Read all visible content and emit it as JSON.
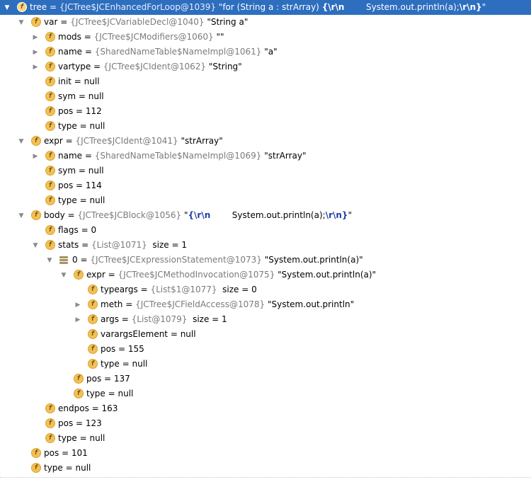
{
  "debugger_tree": {
    "rows": [
      {
        "depth": 0,
        "expand": "down",
        "icon": "field",
        "selected": true,
        "name": "tree",
        "eq": " = ",
        "ref": "{JCTree$JCEnhancedForLoop@1039}",
        "value_parts": [
          {
            "t": " \"for (String a : strArray) "
          },
          {
            "t": "{\\r\\n",
            "esc": true
          },
          {
            "t": "        System.out.println(a);"
          },
          {
            "t": "\\r\\n}",
            "esc": true
          },
          {
            "t": "\""
          }
        ]
      },
      {
        "depth": 1,
        "expand": "down",
        "icon": "field",
        "name": "var",
        "eq": " = ",
        "ref": "{JCTree$JCVariableDecl@1040}",
        "value_parts": [
          {
            "t": " \"String a\""
          }
        ]
      },
      {
        "depth": 2,
        "expand": "right",
        "icon": "field",
        "name": "mods",
        "eq": " = ",
        "ref": "{JCTree$JCModifiers@1060}",
        "value_parts": [
          {
            "t": " \"\""
          }
        ]
      },
      {
        "depth": 2,
        "expand": "right",
        "icon": "field",
        "name": "name",
        "eq": " = ",
        "ref": "{SharedNameTable$NameImpl@1061}",
        "value_parts": [
          {
            "t": " \"a\""
          }
        ]
      },
      {
        "depth": 2,
        "expand": "right",
        "icon": "field",
        "name": "vartype",
        "eq": " = ",
        "ref": "{JCTree$JCIdent@1062}",
        "value_parts": [
          {
            "t": " \"String\""
          }
        ]
      },
      {
        "depth": 2,
        "expand": "none",
        "icon": "field",
        "name": "init",
        "eq": " = ",
        "ref": "",
        "value_parts": [
          {
            "t": "null"
          }
        ]
      },
      {
        "depth": 2,
        "expand": "none",
        "icon": "field",
        "name": "sym",
        "eq": " = ",
        "ref": "",
        "value_parts": [
          {
            "t": "null"
          }
        ]
      },
      {
        "depth": 2,
        "expand": "none",
        "icon": "field",
        "name": "pos",
        "eq": " = ",
        "ref": "",
        "value_parts": [
          {
            "t": "112"
          }
        ]
      },
      {
        "depth": 2,
        "expand": "none",
        "icon": "field",
        "name": "type",
        "eq": " = ",
        "ref": "",
        "value_parts": [
          {
            "t": "null"
          }
        ]
      },
      {
        "depth": 1,
        "expand": "down",
        "icon": "field",
        "name": "expr",
        "eq": " = ",
        "ref": "{JCTree$JCIdent@1041}",
        "value_parts": [
          {
            "t": " \"strArray\""
          }
        ]
      },
      {
        "depth": 2,
        "expand": "right",
        "icon": "field",
        "name": "name",
        "eq": " = ",
        "ref": "{SharedNameTable$NameImpl@1069}",
        "value_parts": [
          {
            "t": " \"strArray\""
          }
        ]
      },
      {
        "depth": 2,
        "expand": "none",
        "icon": "field",
        "name": "sym",
        "eq": " = ",
        "ref": "",
        "value_parts": [
          {
            "t": "null"
          }
        ]
      },
      {
        "depth": 2,
        "expand": "none",
        "icon": "field",
        "name": "pos",
        "eq": " = ",
        "ref": "",
        "value_parts": [
          {
            "t": "114"
          }
        ]
      },
      {
        "depth": 2,
        "expand": "none",
        "icon": "field",
        "name": "type",
        "eq": " = ",
        "ref": "",
        "value_parts": [
          {
            "t": "null"
          }
        ]
      },
      {
        "depth": 1,
        "expand": "down",
        "icon": "field",
        "name": "body",
        "eq": " = ",
        "ref": "{JCTree$JCBlock@1056}",
        "value_parts": [
          {
            "t": " \""
          },
          {
            "t": "{\\r\\n",
            "esc": true
          },
          {
            "t": "        System.out.println(a);"
          },
          {
            "t": "\\r\\n}",
            "esc": true
          },
          {
            "t": "\""
          }
        ]
      },
      {
        "depth": 2,
        "expand": "none",
        "icon": "field",
        "name": "flags",
        "eq": " = ",
        "ref": "",
        "value_parts": [
          {
            "t": "0"
          }
        ]
      },
      {
        "depth": 2,
        "expand": "down",
        "icon": "field",
        "name": "stats",
        "eq": " = ",
        "ref": "{List@1071}",
        "value_parts": [
          {
            "t": "  size = 1"
          }
        ]
      },
      {
        "depth": 3,
        "expand": "down",
        "icon": "array",
        "name": "0",
        "eq": " = ",
        "ref": "{JCTree$JCExpressionStatement@1073}",
        "value_parts": [
          {
            "t": " \"System.out.println(a)\""
          }
        ]
      },
      {
        "depth": 4,
        "expand": "down",
        "icon": "field",
        "name": "expr",
        "eq": " = ",
        "ref": "{JCTree$JCMethodInvocation@1075}",
        "value_parts": [
          {
            "t": " \"System.out.println(a)\""
          }
        ]
      },
      {
        "depth": 5,
        "expand": "none",
        "icon": "field",
        "name": "typeargs",
        "eq": " = ",
        "ref": "{List$1@1077}",
        "value_parts": [
          {
            "t": "  size = 0"
          }
        ]
      },
      {
        "depth": 5,
        "expand": "right",
        "icon": "field",
        "name": "meth",
        "eq": " = ",
        "ref": "{JCTree$JCFieldAccess@1078}",
        "value_parts": [
          {
            "t": " \"System.out.println\""
          }
        ]
      },
      {
        "depth": 5,
        "expand": "right",
        "icon": "field",
        "name": "args",
        "eq": " = ",
        "ref": "{List@1079}",
        "value_parts": [
          {
            "t": "  size = 1"
          }
        ]
      },
      {
        "depth": 5,
        "expand": "none",
        "icon": "field",
        "name": "varargsElement",
        "eq": " = ",
        "ref": "",
        "value_parts": [
          {
            "t": "null"
          }
        ]
      },
      {
        "depth": 5,
        "expand": "none",
        "icon": "field",
        "name": "pos",
        "eq": " = ",
        "ref": "",
        "value_parts": [
          {
            "t": "155"
          }
        ]
      },
      {
        "depth": 5,
        "expand": "none",
        "icon": "field",
        "name": "type",
        "eq": " = ",
        "ref": "",
        "value_parts": [
          {
            "t": "null"
          }
        ]
      },
      {
        "depth": 4,
        "expand": "none",
        "icon": "field",
        "name": "pos",
        "eq": " = ",
        "ref": "",
        "value_parts": [
          {
            "t": "137"
          }
        ]
      },
      {
        "depth": 4,
        "expand": "none",
        "icon": "field",
        "name": "type",
        "eq": " = ",
        "ref": "",
        "value_parts": [
          {
            "t": "null"
          }
        ]
      },
      {
        "depth": 2,
        "expand": "none",
        "icon": "field",
        "name": "endpos",
        "eq": " = ",
        "ref": "",
        "value_parts": [
          {
            "t": "163"
          }
        ]
      },
      {
        "depth": 2,
        "expand": "none",
        "icon": "field",
        "name": "pos",
        "eq": " = ",
        "ref": "",
        "value_parts": [
          {
            "t": "123"
          }
        ]
      },
      {
        "depth": 2,
        "expand": "none",
        "icon": "field",
        "name": "type",
        "eq": " = ",
        "ref": "",
        "value_parts": [
          {
            "t": "null"
          }
        ]
      },
      {
        "depth": 1,
        "expand": "none",
        "icon": "field",
        "name": "pos",
        "eq": " = ",
        "ref": "",
        "value_parts": [
          {
            "t": "101"
          }
        ]
      },
      {
        "depth": 1,
        "expand": "none",
        "icon": "field",
        "name": "type",
        "eq": " = ",
        "ref": "",
        "value_parts": [
          {
            "t": "null"
          }
        ]
      }
    ]
  },
  "icons": {
    "expanded": "chevron-down-icon",
    "collapsed": "chevron-right-icon",
    "field": "field-f-icon",
    "array": "array-element-icon"
  },
  "glyphs": {
    "field_letter": "f",
    "arrow_down": "▼",
    "arrow_right": "▶"
  },
  "colors": {
    "selection": "#2d6ebf",
    "field_badge": "#f2c155",
    "reference_gray": "#7b7b7b",
    "escape_blue": "#1f3fa8"
  }
}
